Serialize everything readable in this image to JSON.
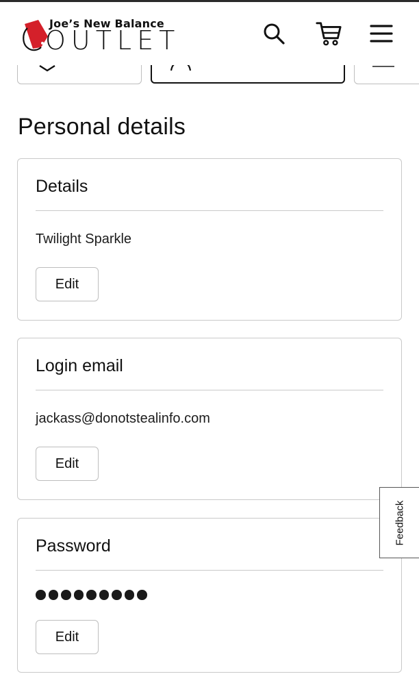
{
  "header": {
    "logo_top": "Joe’s New Balance",
    "logo_bottom": "OUTLET",
    "icons": [
      "search-icon",
      "cart-icon",
      "menu-icon"
    ],
    "brand_red": "#d4202a"
  },
  "page": {
    "title": "Personal details"
  },
  "cards": {
    "details": {
      "heading": "Details",
      "value": "Twilight Sparkle",
      "edit_label": "Edit"
    },
    "login_email": {
      "heading": "Login email",
      "value": "jackass@donotstealinfo.com",
      "edit_label": "Edit"
    },
    "password": {
      "heading": "Password",
      "masked_length": 9,
      "edit_label": "Edit"
    }
  },
  "feedback": {
    "label": "Feedback"
  }
}
